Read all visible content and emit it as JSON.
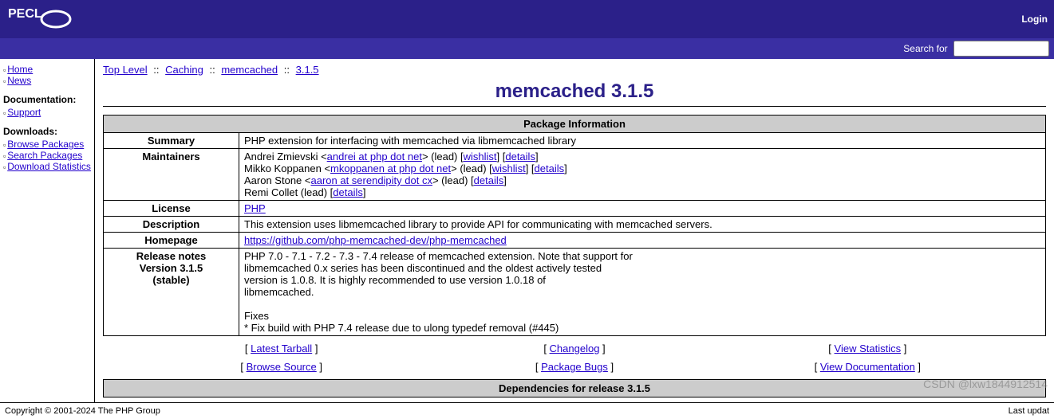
{
  "header": {
    "logo": "PECL",
    "login": "Login",
    "search_label": "Search for",
    "search_value": ""
  },
  "sidebar": {
    "nav": [
      {
        "label": "Home"
      },
      {
        "label": "News"
      }
    ],
    "doc_heading": "Documentation:",
    "doc_items": [
      {
        "label": "Support"
      }
    ],
    "dl_heading": "Downloads:",
    "dl_items": [
      {
        "label": "Browse Packages"
      },
      {
        "label": "Search Packages"
      },
      {
        "label": "Download Statistics"
      }
    ]
  },
  "breadcrumb": {
    "items": [
      "Top Level",
      "Caching",
      "memcached",
      "3.1.5"
    ],
    "sep": "::"
  },
  "title": "memcached 3.1.5",
  "pkg": {
    "section_title": "Package Information",
    "summary": {
      "label": "Summary",
      "value": "PHP extension for interfacing with memcached via libmemcached library"
    },
    "maintainers": {
      "label": "Maintainers",
      "entries": [
        {
          "name": "Andrei Zmievski",
          "email": "andrei at php dot net",
          "role": "(lead)",
          "wishlist": "wishlist",
          "details": "details"
        },
        {
          "name": "Mikko Koppanen",
          "email": "mkoppanen at php dot net",
          "role": "(lead)",
          "wishlist": "wishlist",
          "details": "details"
        },
        {
          "name": "Aaron Stone",
          "email": "aaron at serendipity dot cx",
          "role": "(lead)",
          "wishlist": null,
          "details": "details"
        },
        {
          "name": "Remi Collet",
          "email": null,
          "role": "(lead)",
          "wishlist": null,
          "details": "details"
        }
      ]
    },
    "license": {
      "label": "License",
      "value": "PHP"
    },
    "description": {
      "label": "Description",
      "value": "This extension uses libmemcached library to provide API for communicating with memcached servers."
    },
    "homepage": {
      "label": "Homepage",
      "value": "https://github.com/php-memcached-dev/php-memcached"
    },
    "release": {
      "label": "Release notes\nVersion 3.1.5\n(stable)",
      "value": "PHP 7.0 - 7.1 - 7.2 - 7.3 - 7.4 release of memcached extension. Note that support for\nlibmemcached 0.x series has been discontinued and the oldest actively tested\nversion is 1.0.8. It is highly recommended to use version 1.0.18 of\nlibmemcached.\n\nFixes\n* Fix build with PHP 7.4 release due to ulong typedef removal (#445)"
    }
  },
  "actions": {
    "row1": [
      {
        "label": "Latest Tarball"
      },
      {
        "label": "Changelog"
      },
      {
        "label": "View Statistics"
      }
    ],
    "row2": [
      {
        "label": "Browse Source"
      },
      {
        "label": "Package Bugs"
      },
      {
        "label": "View Documentation"
      }
    ]
  },
  "deps_header": "Dependencies for release 3.1.5",
  "footer": {
    "copyright": "Copyright © 2001-2024 The PHP Group",
    "last": "Last updat"
  },
  "watermark": "CSDN @lxw1844912514"
}
